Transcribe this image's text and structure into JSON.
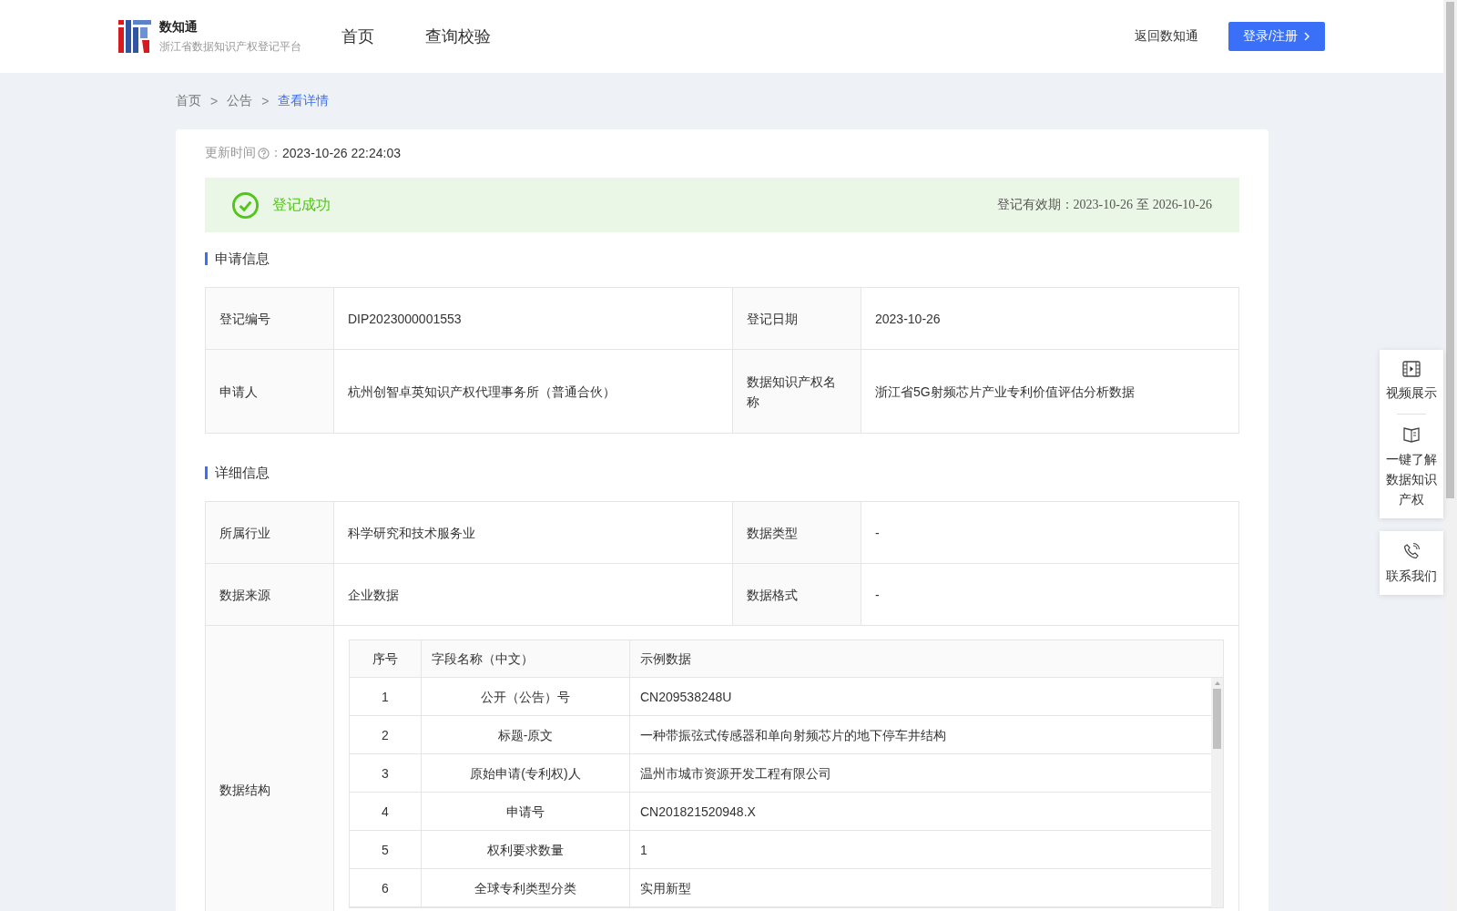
{
  "header": {
    "logo_title": "数知通",
    "logo_subtitle": "浙江省数据知识产权登记平台",
    "nav": [
      {
        "label": "首页",
        "selected": false
      },
      {
        "label": "查询校验",
        "selected": false
      }
    ],
    "back_link": "返回数知通",
    "login_button": "登录/注册"
  },
  "breadcrumb": [
    {
      "label": "首页",
      "selected": false
    },
    {
      "label": "公告",
      "selected": false
    },
    {
      "label": "查看详情",
      "selected": true
    }
  ],
  "breadcrumb_separator": ">",
  "update_time": {
    "label": "更新时间",
    "separator": "：",
    "value": "2023-10-26 22:24:03"
  },
  "status": {
    "text": "登记成功",
    "validity_label": "登记有效期：",
    "validity_from": "2023-10-26",
    "validity_to_word": "至",
    "validity_to": "2026-10-26"
  },
  "application_info": {
    "title": "申请信息",
    "rows": [
      {
        "cells": [
          {
            "label": "登记编号",
            "value": "DIP2023000001553"
          },
          {
            "label": "登记日期",
            "value": "2023-10-26"
          }
        ]
      },
      {
        "cells": [
          {
            "label": "申请人",
            "value": "杭州创智卓英知识产权代理事务所（普通合伙）"
          },
          {
            "label": "数据知识产权名称",
            "value": "浙江省5G射频芯片产业专利价值评估分析数据"
          }
        ]
      }
    ]
  },
  "detail_info": {
    "title": "详细信息",
    "rows": [
      {
        "cells": [
          {
            "label": "所属行业",
            "value": "科学研究和技术服务业"
          },
          {
            "label": "数据类型",
            "value": "-"
          }
        ]
      },
      {
        "cells": [
          {
            "label": "数据来源",
            "value": "企业数据"
          },
          {
            "label": "数据格式",
            "value": "-"
          }
        ]
      }
    ],
    "structure_label": "数据结构",
    "structure_table": {
      "columns": [
        "序号",
        "字段名称（中文）",
        "示例数据"
      ],
      "rows": [
        [
          "1",
          "公开（公告）号",
          "CN209538248U"
        ],
        [
          "2",
          "标题-原文",
          "一种带振弦式传感器和单向射频芯片的地下停车井结构"
        ],
        [
          "3",
          "原始申请(专利权)人",
          "温州市城市资源开发工程有限公司"
        ],
        [
          "4",
          "申请号",
          "CN201821520948.X"
        ],
        [
          "5",
          "权利要求数量",
          "1"
        ],
        [
          "6",
          "全球专利类型分类",
          "实用新型"
        ]
      ]
    }
  },
  "side_tools": [
    {
      "kind": "video",
      "label": "视频展示"
    },
    {
      "kind": "book",
      "label": "一键了解数据知识产权"
    },
    {
      "kind": "phone",
      "label": "联系我们"
    }
  ]
}
